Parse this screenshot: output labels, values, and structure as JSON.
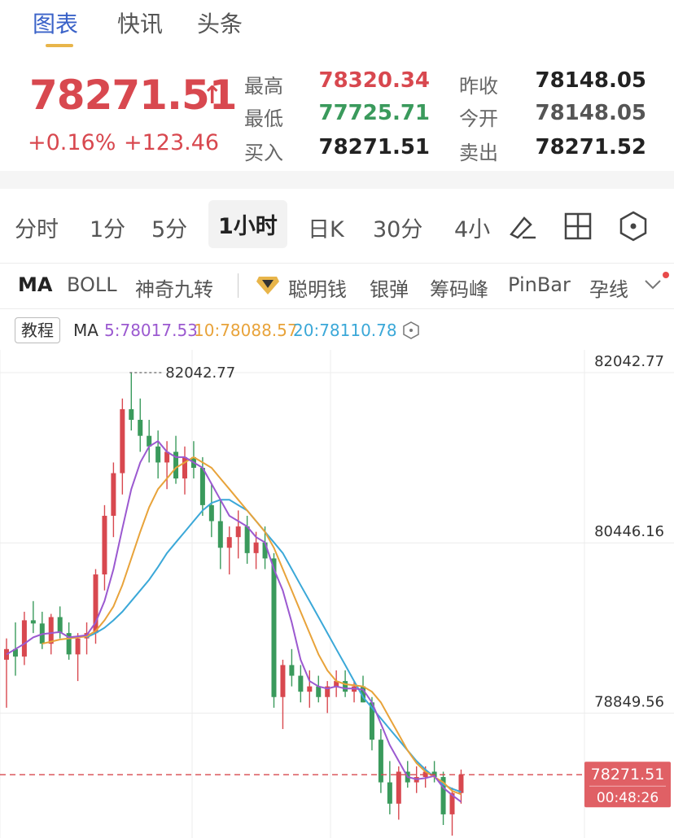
{
  "tabs": [
    "图表",
    "快讯",
    "头条"
  ],
  "quote": {
    "price": "78271.51",
    "change_pct": "+0.16%",
    "change_abs": "+123.46",
    "high_label": "最高",
    "high": "78320.34",
    "low_label": "最低",
    "low": "77725.71",
    "buy_label": "买入",
    "buy": "78271.51",
    "prev_close_label": "昨收",
    "prev_close": "78148.05",
    "open_label": "今开",
    "open": "78148.05",
    "sell_label": "卖出",
    "sell": "78271.52"
  },
  "periods": [
    "分时",
    "1分",
    "5分",
    "1小时",
    "日K",
    "30分",
    "4小"
  ],
  "active_period": "1小时",
  "indicators": [
    "MA",
    "BOLL",
    "神奇九转",
    "聪明钱",
    "银弹",
    "筹码峰",
    "PinBar",
    "孕线"
  ],
  "tutorial_label": "教程",
  "ma": {
    "label": "MA",
    "ma5": "5:78017.53",
    "ma10": "10:78088.57",
    "ma20": "20:78110.78"
  },
  "colors": {
    "up": "#d8484f",
    "down": "#3a9a5c",
    "ma5": "#9b59d0",
    "ma10": "#e8a33a",
    "ma20": "#3ba8d8",
    "accent": "#3a62c8"
  },
  "chart_data": {
    "type": "candlestick",
    "y_ticks": [
      "82042.77",
      "80446.16",
      "78849.56"
    ],
    "high_marker": "82042.77",
    "current_price_tag": "78271.51",
    "countdown": "00:48:26",
    "ylim": [
      77600,
      82300
    ],
    "current_price": 78271.51,
    "candles": [
      [
        79350,
        79550,
        78900,
        79450
      ],
      [
        79450,
        79700,
        79200,
        79380
      ],
      [
        79380,
        79800,
        79300,
        79720
      ],
      [
        79720,
        79900,
        79600,
        79690
      ],
      [
        79690,
        79800,
        79450,
        79500
      ],
      [
        79500,
        79780,
        79400,
        79750
      ],
      [
        79750,
        79850,
        79550,
        79600
      ],
      [
        79600,
        79700,
        79350,
        79400
      ],
      [
        79400,
        79600,
        79150,
        79550
      ],
      [
        79550,
        79700,
        79400,
        79600
      ],
      [
        79600,
        80200,
        79500,
        80150
      ],
      [
        80150,
        80800,
        80000,
        80700
      ],
      [
        80700,
        81200,
        80500,
        81100
      ],
      [
        81100,
        81800,
        80900,
        81700
      ],
      [
        81700,
        82042,
        81500,
        81600
      ],
      [
        81600,
        81800,
        81300,
        81450
      ],
      [
        81450,
        81600,
        81200,
        81350
      ],
      [
        81350,
        81500,
        81050,
        81200
      ],
      [
        81200,
        81400,
        80950,
        81300
      ],
      [
        81300,
        81450,
        81000,
        81050
      ],
      [
        81050,
        81350,
        80900,
        81250
      ],
      [
        81250,
        81400,
        81050,
        81150
      ],
      [
        81150,
        81250,
        80700,
        80800
      ],
      [
        80800,
        81000,
        80500,
        80650
      ],
      [
        80650,
        80850,
        80200,
        80400
      ],
      [
        80400,
        80600,
        80150,
        80500
      ],
      [
        80500,
        80750,
        80300,
        80600
      ],
      [
        80600,
        80700,
        80250,
        80350
      ],
      [
        80350,
        80550,
        80200,
        80450
      ],
      [
        80450,
        80600,
        80200,
        80300
      ],
      [
        80300,
        80350,
        78900,
        79000
      ],
      [
        79000,
        79350,
        78700,
        79300
      ],
      [
        79300,
        79450,
        79100,
        79200
      ],
      [
        79200,
        79300,
        78950,
        79050
      ],
      [
        79050,
        79250,
        78900,
        79100
      ],
      [
        79100,
        79200,
        78950,
        79000
      ],
      [
        79000,
        79150,
        78850,
        79100
      ],
      [
        79100,
        79250,
        79000,
        79150
      ],
      [
        79150,
        79250,
        79000,
        79050
      ],
      [
        79050,
        79150,
        78950,
        79100
      ],
      [
        79100,
        79200,
        78950,
        78950
      ],
      [
        78950,
        79000,
        78500,
        78600
      ],
      [
        78600,
        78700,
        78100,
        78200
      ],
      [
        78200,
        78400,
        77900,
        78000
      ],
      [
        78000,
        78350,
        77850,
        78300
      ],
      [
        78300,
        78400,
        78150,
        78200
      ],
      [
        78200,
        78350,
        78100,
        78250
      ],
      [
        78250,
        78350,
        78150,
        78300
      ],
      [
        78300,
        78400,
        78200,
        78250
      ],
      [
        78250,
        78300,
        77800,
        77900
      ],
      [
        77900,
        78150,
        77700,
        78100
      ],
      [
        78100,
        78320,
        78000,
        78271.51
      ]
    ],
    "ma5": [
      79400,
      79450,
      79500,
      79560,
      79590,
      79600,
      79610,
      79560,
      79570,
      79580,
      79700,
      79900,
      80200,
      80580,
      80950,
      81200,
      81350,
      81400,
      81300,
      81250,
      81250,
      81200,
      81150,
      81000,
      80850,
      80700,
      80650,
      80600,
      80500,
      80450,
      80200,
      80000,
      79700,
      79350,
      79150,
      79100,
      79080,
      79100,
      79080,
      79080,
      79070,
      78950,
      78750,
      78550,
      78400,
      78250,
      78230,
      78240,
      78260,
      78150,
      78080,
      78017
    ],
    "ma10": [
      null,
      null,
      null,
      null,
      79500,
      79520,
      79540,
      79550,
      79560,
      79570,
      79620,
      79720,
      79850,
      80050,
      80300,
      80550,
      80780,
      80950,
      81050,
      81150,
      81200,
      81250,
      81200,
      81150,
      81050,
      80950,
      80850,
      80750,
      80650,
      80550,
      80400,
      80200,
      80000,
      79800,
      79600,
      79400,
      79250,
      79150,
      79120,
      79110,
      79100,
      79050,
      78950,
      78800,
      78650,
      78500,
      78380,
      78300,
      78250,
      78200,
      78120,
      78088
    ],
    "ma20": [
      null,
      null,
      null,
      null,
      null,
      null,
      null,
      null,
      null,
      79560,
      79600,
      79650,
      79720,
      79800,
      79900,
      80000,
      80100,
      80220,
      80350,
      80450,
      80550,
      80650,
      80750,
      80820,
      80850,
      80850,
      80800,
      80750,
      80650,
      80550,
      80450,
      80350,
      80200,
      80050,
      79900,
      79750,
      79600,
      79450,
      79300,
      79150,
      79000,
      78900,
      78800,
      78700,
      78600,
      78500,
      78400,
      78320,
      78250,
      78180,
      78140,
      78110
    ]
  }
}
